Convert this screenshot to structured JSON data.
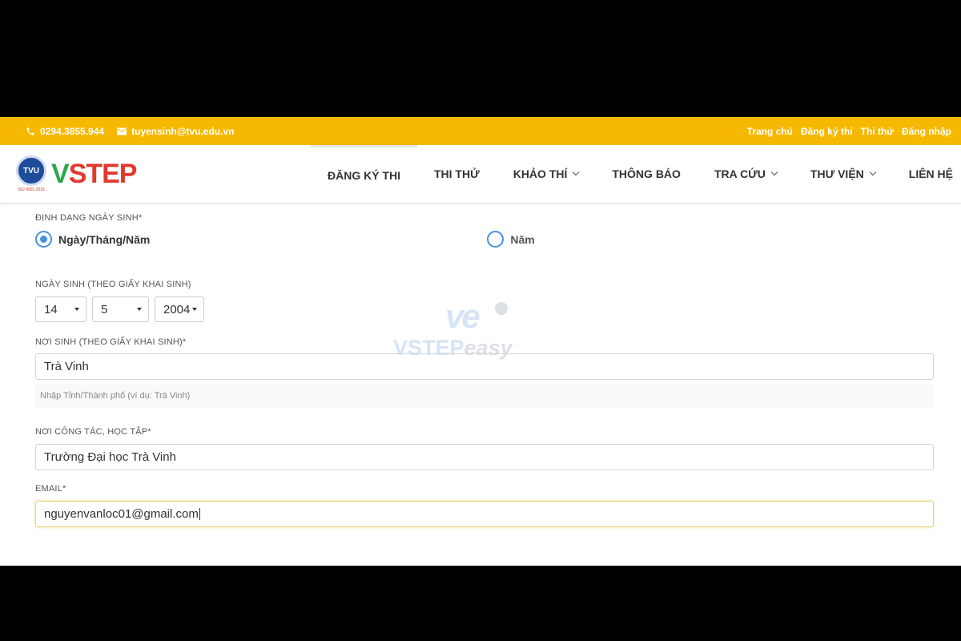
{
  "topbar": {
    "phone": "0294.3855.944",
    "email": "tuyensinh@tvu.edu.vn",
    "links": [
      "Trang chủ",
      "Đăng ký thi",
      "Thi thử",
      "Đăng nhập"
    ]
  },
  "brand": {
    "seal_text": "TVU",
    "seal_sub": "ISO 9001:2015",
    "logo_v": "V",
    "logo_rest": "STEP"
  },
  "nav": [
    {
      "label": "ĐĂNG KÝ THI",
      "has_menu": false
    },
    {
      "label": "THI THỬ",
      "has_menu": false
    },
    {
      "label": "KHẢO THÍ",
      "has_menu": true
    },
    {
      "label": "THÔNG BÁO",
      "has_menu": false
    },
    {
      "label": "TRA CỨU",
      "has_menu": true
    },
    {
      "label": "THƯ VIỆN",
      "has_menu": true
    },
    {
      "label": "LIÊN HỆ",
      "has_menu": false
    }
  ],
  "form": {
    "dob_format": {
      "label": "ĐỊNH DẠNG NGÀY SINH*",
      "options": [
        "Ngày/Tháng/Năm",
        "Năm"
      ],
      "selected": "Ngày/Tháng/Năm"
    },
    "dob": {
      "label": "NGÀY SINH (THEO GIẤY KHAI SINH)",
      "day": "14",
      "month": "5",
      "year": "2004"
    },
    "birthplace": {
      "label": "NƠI SINH (THEO GIẤY KHAI SINH)*",
      "value": "Trà Vinh",
      "hint": "Nhập Tỉnh/Thành phố (ví dụ: Trà Vinh)"
    },
    "workplace": {
      "label": "NƠI CÔNG TÁC, HỌC TẬP*",
      "value": "Trường Đại học Trà Vinh"
    },
    "email": {
      "label": "EMAIL*",
      "value": "nguyenvanloc01@gmail.com"
    }
  },
  "watermark": {
    "mark": "ve",
    "text_a": "VSTEP",
    "text_b": "easy"
  },
  "colors": {
    "topbar": "#f6b800",
    "radio": "#4a90e2",
    "logo_green": "#2aa84a",
    "logo_red": "#e03a2f"
  }
}
